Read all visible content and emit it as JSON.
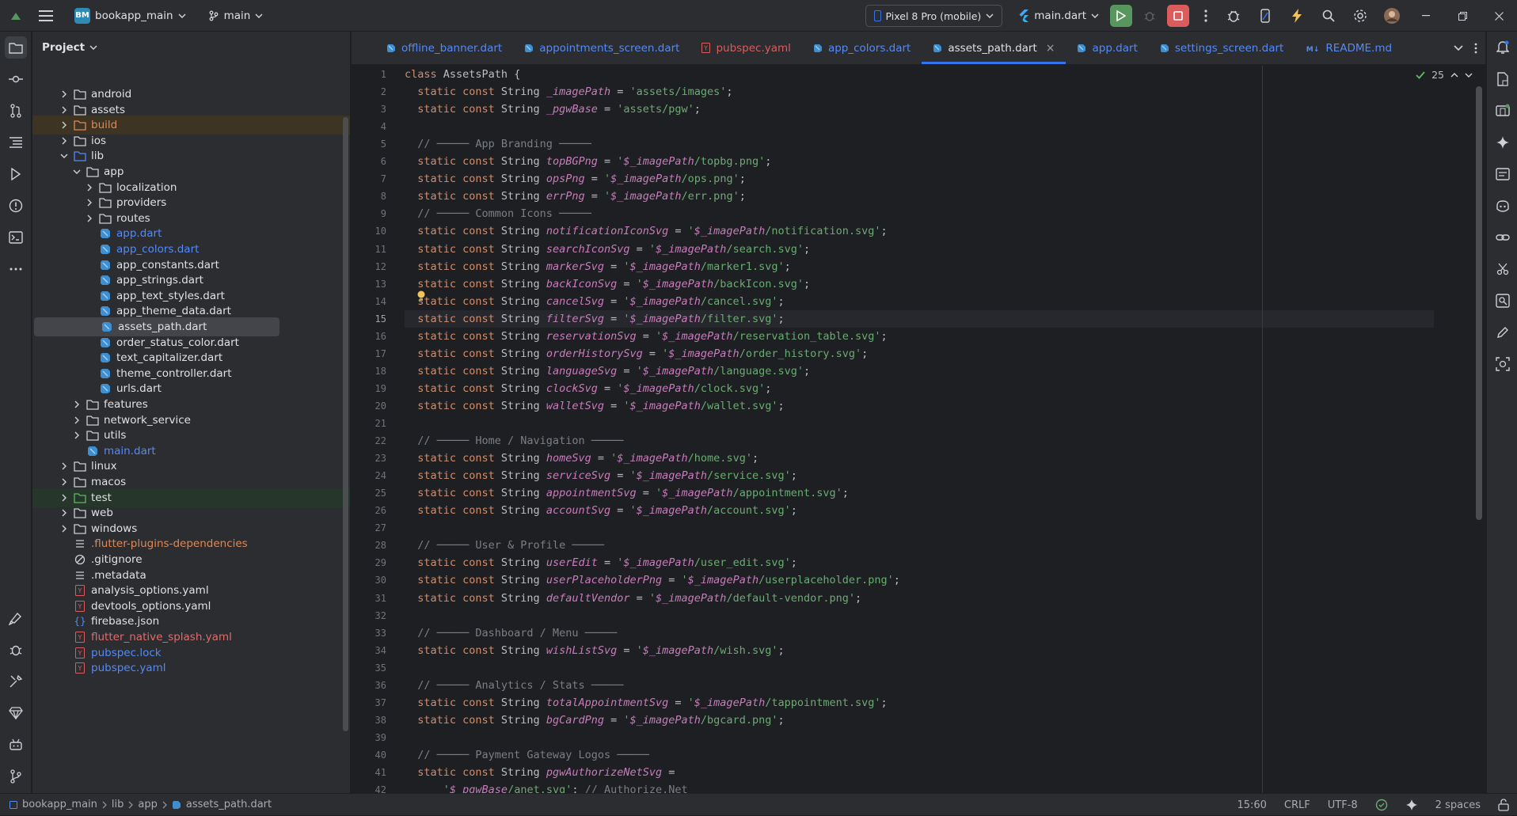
{
  "titlebar": {
    "project_badge": "BM",
    "project_name": "bookapp_main",
    "branch": "main",
    "device": "Pixel 8 Pro (mobile)",
    "run_config": "main.dart",
    "colors": {
      "run": "#57965c",
      "stop": "#db5c5c",
      "badge": "#2e8bb5"
    }
  },
  "project_panel": {
    "title": "Project",
    "tree": [
      {
        "label": "android",
        "type": "folder",
        "depth": 1,
        "expanded": false
      },
      {
        "label": "assets",
        "type": "folder",
        "depth": 1,
        "expanded": false
      },
      {
        "label": "build",
        "type": "folder-excluded",
        "depth": 1,
        "expanded": false
      },
      {
        "label": "ios",
        "type": "folder",
        "depth": 1,
        "expanded": false
      },
      {
        "label": "lib",
        "type": "folder-source",
        "depth": 1,
        "expanded": true
      },
      {
        "label": "app",
        "type": "folder",
        "depth": 2,
        "expanded": true
      },
      {
        "label": "localization",
        "type": "folder",
        "depth": 3,
        "expanded": false
      },
      {
        "label": "providers",
        "type": "folder",
        "depth": 3,
        "expanded": false
      },
      {
        "label": "routes",
        "type": "folder",
        "depth": 3,
        "expanded": false
      },
      {
        "label": "app.dart",
        "type": "dart-modified",
        "depth": 3
      },
      {
        "label": "app_colors.dart",
        "type": "dart-modified",
        "depth": 3
      },
      {
        "label": "app_constants.dart",
        "type": "dart",
        "depth": 3
      },
      {
        "label": "app_strings.dart",
        "type": "dart",
        "depth": 3
      },
      {
        "label": "app_text_styles.dart",
        "type": "dart",
        "depth": 3
      },
      {
        "label": "app_theme_data.dart",
        "type": "dart",
        "depth": 3
      },
      {
        "label": "assets_path.dart",
        "type": "dart",
        "depth": 3,
        "selected": true
      },
      {
        "label": "order_status_color.dart",
        "type": "dart",
        "depth": 3
      },
      {
        "label": "text_capitalizer.dart",
        "type": "dart",
        "depth": 3
      },
      {
        "label": "theme_controller.dart",
        "type": "dart",
        "depth": 3
      },
      {
        "label": "urls.dart",
        "type": "dart",
        "depth": 3
      },
      {
        "label": "features",
        "type": "folder",
        "depth": 2,
        "expanded": false
      },
      {
        "label": "network_service",
        "type": "folder",
        "depth": 2,
        "expanded": false
      },
      {
        "label": "utils",
        "type": "folder",
        "depth": 2,
        "expanded": false
      },
      {
        "label": "main.dart",
        "type": "dart-modified",
        "depth": 2
      },
      {
        "label": "linux",
        "type": "folder",
        "depth": 1,
        "expanded": false
      },
      {
        "label": "macos",
        "type": "folder",
        "depth": 1,
        "expanded": false
      },
      {
        "label": "test",
        "type": "folder-test",
        "depth": 1,
        "expanded": false
      },
      {
        "label": "web",
        "type": "folder",
        "depth": 1,
        "expanded": false
      },
      {
        "label": "windows",
        "type": "folder",
        "depth": 1,
        "expanded": false
      },
      {
        "label": ".flutter-plugins-dependencies",
        "type": "text-orange",
        "depth": 1
      },
      {
        "label": ".gitignore",
        "type": "ignore",
        "depth": 1
      },
      {
        "label": ".metadata",
        "type": "text",
        "depth": 1
      },
      {
        "label": "analysis_options.yaml",
        "type": "yaml",
        "depth": 1
      },
      {
        "label": "devtools_options.yaml",
        "type": "yaml",
        "depth": 1
      },
      {
        "label": "firebase.json",
        "type": "json",
        "depth": 1
      },
      {
        "label": "flutter_native_splash.yaml",
        "type": "yaml-orange",
        "depth": 1
      },
      {
        "label": "pubspec.lock",
        "type": "yaml-blue",
        "depth": 1
      },
      {
        "label": "pubspec.yaml",
        "type": "yaml-blue",
        "depth": 1
      }
    ]
  },
  "tabs": [
    {
      "label": "offline_banner.dart",
      "icon": "dart",
      "active": false
    },
    {
      "label": "appointments_screen.dart",
      "icon": "dart",
      "active": false
    },
    {
      "label": "pubspec.yaml",
      "icon": "yaml",
      "active": false
    },
    {
      "label": "app_colors.dart",
      "icon": "dart",
      "active": false
    },
    {
      "label": "assets_path.dart",
      "icon": "dart",
      "active": true
    },
    {
      "label": "app.dart",
      "icon": "dart",
      "active": false
    },
    {
      "label": "settings_screen.dart",
      "icon": "dart",
      "active": false
    },
    {
      "label": "README.md",
      "icon": "markdown",
      "active": false
    }
  ],
  "tab_close": "×",
  "editor": {
    "inspection_count": "25",
    "current_line": 15,
    "lines": [
      [
        [
          "kw",
          "class "
        ],
        [
          "cls",
          "AssetsPath "
        ],
        [
          "pl",
          "{"
        ]
      ],
      [
        [
          "kw",
          "  static const "
        ],
        [
          "cls",
          "String "
        ],
        [
          "fld",
          "_imagePath"
        ],
        [
          "pl",
          " = "
        ],
        [
          "str",
          "'assets/images'"
        ],
        [
          "pl",
          ";"
        ]
      ],
      [
        [
          "kw",
          "  static const "
        ],
        [
          "cls",
          "String "
        ],
        [
          "fld",
          "_pgwBase"
        ],
        [
          "pl",
          " = "
        ],
        [
          "str",
          "'assets/pgw'"
        ],
        [
          "pl",
          ";"
        ]
      ],
      [],
      [
        [
          "cmt",
          "  // ───── App Branding ─────"
        ]
      ],
      [
        [
          "kw",
          "  static const "
        ],
        [
          "cls",
          "String "
        ],
        [
          "fld",
          "topBGPng"
        ],
        [
          "pl",
          " = "
        ],
        [
          "str",
          "'"
        ],
        [
          "fld",
          "$_imagePath"
        ],
        [
          "str",
          "/topbg.png'"
        ],
        [
          "pl",
          ";"
        ]
      ],
      [
        [
          "kw",
          "  static const "
        ],
        [
          "cls",
          "String "
        ],
        [
          "fld",
          "opsPng"
        ],
        [
          "pl",
          " = "
        ],
        [
          "str",
          "'"
        ],
        [
          "fld",
          "$_imagePath"
        ],
        [
          "str",
          "/ops.png'"
        ],
        [
          "pl",
          ";"
        ]
      ],
      [
        [
          "kw",
          "  static const "
        ],
        [
          "cls",
          "String "
        ],
        [
          "fld",
          "errPng"
        ],
        [
          "pl",
          " = "
        ],
        [
          "str",
          "'"
        ],
        [
          "fld",
          "$_imagePath"
        ],
        [
          "str",
          "/err.png'"
        ],
        [
          "pl",
          ";"
        ]
      ],
      [
        [
          "cmt",
          "  // ───── Common Icons ─────"
        ]
      ],
      [
        [
          "kw",
          "  static const "
        ],
        [
          "cls",
          "String "
        ],
        [
          "fld",
          "notificationIconSvg"
        ],
        [
          "pl",
          " = "
        ],
        [
          "str",
          "'"
        ],
        [
          "fld",
          "$_imagePath"
        ],
        [
          "str",
          "/notification.svg'"
        ],
        [
          "pl",
          ";"
        ]
      ],
      [
        [
          "kw",
          "  static const "
        ],
        [
          "cls",
          "String "
        ],
        [
          "fld",
          "searchIconSvg"
        ],
        [
          "pl",
          " = "
        ],
        [
          "str",
          "'"
        ],
        [
          "fld",
          "$_imagePath"
        ],
        [
          "str",
          "/search.svg'"
        ],
        [
          "pl",
          ";"
        ]
      ],
      [
        [
          "kw",
          "  static const "
        ],
        [
          "cls",
          "String "
        ],
        [
          "fld",
          "markerSvg"
        ],
        [
          "pl",
          " = "
        ],
        [
          "str",
          "'"
        ],
        [
          "fld",
          "$_imagePath"
        ],
        [
          "str",
          "/marker1.svg'"
        ],
        [
          "pl",
          ";"
        ]
      ],
      [
        [
          "kw",
          "  static const "
        ],
        [
          "cls",
          "String "
        ],
        [
          "fld",
          "backIconSvg"
        ],
        [
          "pl",
          " = "
        ],
        [
          "str",
          "'"
        ],
        [
          "fld",
          "$_imagePath"
        ],
        [
          "str",
          "/backIcon.svg'"
        ],
        [
          "pl",
          ";"
        ]
      ],
      [
        [
          "kw",
          "  static const "
        ],
        [
          "cls",
          "String "
        ],
        [
          "fld",
          "cancelSvg"
        ],
        [
          "pl",
          " = "
        ],
        [
          "str",
          "'"
        ],
        [
          "fld",
          "$_imagePath"
        ],
        [
          "str",
          "/cancel.svg'"
        ],
        [
          "pl",
          ";"
        ]
      ],
      [
        [
          "kw",
          "  static const "
        ],
        [
          "cls",
          "String "
        ],
        [
          "fld",
          "filterSvg"
        ],
        [
          "pl",
          " = "
        ],
        [
          "str",
          "'"
        ],
        [
          "fld",
          "$_imagePath"
        ],
        [
          "str",
          "/filter.svg'"
        ],
        [
          "pl",
          ";"
        ]
      ],
      [
        [
          "kw",
          "  static const "
        ],
        [
          "cls",
          "String "
        ],
        [
          "fld",
          "reservationSvg"
        ],
        [
          "pl",
          " = "
        ],
        [
          "str",
          "'"
        ],
        [
          "fld",
          "$_imagePath"
        ],
        [
          "str",
          "/reservation_table.svg'"
        ],
        [
          "pl",
          ";"
        ]
      ],
      [
        [
          "kw",
          "  static const "
        ],
        [
          "cls",
          "String "
        ],
        [
          "fld",
          "orderHistorySvg"
        ],
        [
          "pl",
          " = "
        ],
        [
          "str",
          "'"
        ],
        [
          "fld",
          "$_imagePath"
        ],
        [
          "str",
          "/order_history.svg'"
        ],
        [
          "pl",
          ";"
        ]
      ],
      [
        [
          "kw",
          "  static const "
        ],
        [
          "cls",
          "String "
        ],
        [
          "fld",
          "languageSvg"
        ],
        [
          "pl",
          " = "
        ],
        [
          "str",
          "'"
        ],
        [
          "fld",
          "$_imagePath"
        ],
        [
          "str",
          "/language.svg'"
        ],
        [
          "pl",
          ";"
        ]
      ],
      [
        [
          "kw",
          "  static const "
        ],
        [
          "cls",
          "String "
        ],
        [
          "fld",
          "clockSvg"
        ],
        [
          "pl",
          " = "
        ],
        [
          "str",
          "'"
        ],
        [
          "fld",
          "$_imagePath"
        ],
        [
          "str",
          "/clock.svg'"
        ],
        [
          "pl",
          ";"
        ]
      ],
      [
        [
          "kw",
          "  static const "
        ],
        [
          "cls",
          "String "
        ],
        [
          "fld",
          "walletSvg"
        ],
        [
          "pl",
          " = "
        ],
        [
          "str",
          "'"
        ],
        [
          "fld",
          "$_imagePath"
        ],
        [
          "str",
          "/wallet.svg'"
        ],
        [
          "pl",
          ";"
        ]
      ],
      [],
      [
        [
          "cmt",
          "  // ───── Home / Navigation ─────"
        ]
      ],
      [
        [
          "kw",
          "  static const "
        ],
        [
          "cls",
          "String "
        ],
        [
          "fld",
          "homeSvg"
        ],
        [
          "pl",
          " = "
        ],
        [
          "str",
          "'"
        ],
        [
          "fld",
          "$_imagePath"
        ],
        [
          "str",
          "/home.svg'"
        ],
        [
          "pl",
          ";"
        ]
      ],
      [
        [
          "kw",
          "  static const "
        ],
        [
          "cls",
          "String "
        ],
        [
          "fld",
          "serviceSvg"
        ],
        [
          "pl",
          " = "
        ],
        [
          "str",
          "'"
        ],
        [
          "fld",
          "$_imagePath"
        ],
        [
          "str",
          "/service.svg'"
        ],
        [
          "pl",
          ";"
        ]
      ],
      [
        [
          "kw",
          "  static const "
        ],
        [
          "cls",
          "String "
        ],
        [
          "fld",
          "appointmentSvg"
        ],
        [
          "pl",
          " = "
        ],
        [
          "str",
          "'"
        ],
        [
          "fld",
          "$_imagePath"
        ],
        [
          "str",
          "/appointment.svg'"
        ],
        [
          "pl",
          ";"
        ]
      ],
      [
        [
          "kw",
          "  static const "
        ],
        [
          "cls",
          "String "
        ],
        [
          "fld",
          "accountSvg"
        ],
        [
          "pl",
          " = "
        ],
        [
          "str",
          "'"
        ],
        [
          "fld",
          "$_imagePath"
        ],
        [
          "str",
          "/account.svg'"
        ],
        [
          "pl",
          ";"
        ]
      ],
      [],
      [
        [
          "cmt",
          "  // ───── User & Profile ─────"
        ]
      ],
      [
        [
          "kw",
          "  static const "
        ],
        [
          "cls",
          "String "
        ],
        [
          "fld",
          "userEdit"
        ],
        [
          "pl",
          " = "
        ],
        [
          "str",
          "'"
        ],
        [
          "fld",
          "$_imagePath"
        ],
        [
          "str",
          "/user_edit.svg'"
        ],
        [
          "pl",
          ";"
        ]
      ],
      [
        [
          "kw",
          "  static const "
        ],
        [
          "cls",
          "String "
        ],
        [
          "fld",
          "userPlaceholderPng"
        ],
        [
          "pl",
          " = "
        ],
        [
          "str",
          "'"
        ],
        [
          "fld",
          "$_imagePath"
        ],
        [
          "str",
          "/userplaceholder.png'"
        ],
        [
          "pl",
          ";"
        ]
      ],
      [
        [
          "kw",
          "  static const "
        ],
        [
          "cls",
          "String "
        ],
        [
          "fld",
          "defaultVendor"
        ],
        [
          "pl",
          " = "
        ],
        [
          "str",
          "'"
        ],
        [
          "fld",
          "$_imagePath"
        ],
        [
          "str",
          "/default-vendor.png'"
        ],
        [
          "pl",
          ";"
        ]
      ],
      [],
      [
        [
          "cmt",
          "  // ───── Dashboard / Menu ─────"
        ]
      ],
      [
        [
          "kw",
          "  static const "
        ],
        [
          "cls",
          "String "
        ],
        [
          "fld",
          "wishListSvg"
        ],
        [
          "pl",
          " = "
        ],
        [
          "str",
          "'"
        ],
        [
          "fld",
          "$_imagePath"
        ],
        [
          "str",
          "/wish.svg'"
        ],
        [
          "pl",
          ";"
        ]
      ],
      [],
      [
        [
          "cmt",
          "  // ───── Analytics / Stats ─────"
        ]
      ],
      [
        [
          "kw",
          "  static const "
        ],
        [
          "cls",
          "String "
        ],
        [
          "fld",
          "totalAppointmentSvg"
        ],
        [
          "pl",
          " = "
        ],
        [
          "str",
          "'"
        ],
        [
          "fld",
          "$_imagePath"
        ],
        [
          "str",
          "/tappointment.svg'"
        ],
        [
          "pl",
          ";"
        ]
      ],
      [
        [
          "kw",
          "  static const "
        ],
        [
          "cls",
          "String "
        ],
        [
          "fld",
          "bgCardPng"
        ],
        [
          "pl",
          " = "
        ],
        [
          "str",
          "'"
        ],
        [
          "fld",
          "$_imagePath"
        ],
        [
          "str",
          "/bgcard.png'"
        ],
        [
          "pl",
          ";"
        ]
      ],
      [],
      [
        [
          "cmt",
          "  // ───── Payment Gateway Logos ─────"
        ]
      ],
      [
        [
          "kw",
          "  static const "
        ],
        [
          "cls",
          "String "
        ],
        [
          "fld",
          "pgwAuthorizeNetSvg"
        ],
        [
          "pl",
          " ="
        ]
      ],
      [
        [
          "str",
          "      '"
        ],
        [
          "fld",
          "$_pgwBase"
        ],
        [
          "str",
          "/anet.svg'"
        ],
        [
          "pl",
          "; "
        ],
        [
          "cmt",
          "// Authorize.Net"
        ]
      ]
    ]
  },
  "breadcrumbs": [
    "bookapp_main",
    "lib",
    "app",
    "assets_path.dart"
  ],
  "status": {
    "position": "15:60",
    "line_endings": "CRLF",
    "encoding": "UTF-8",
    "indent": "2 spaces"
  }
}
